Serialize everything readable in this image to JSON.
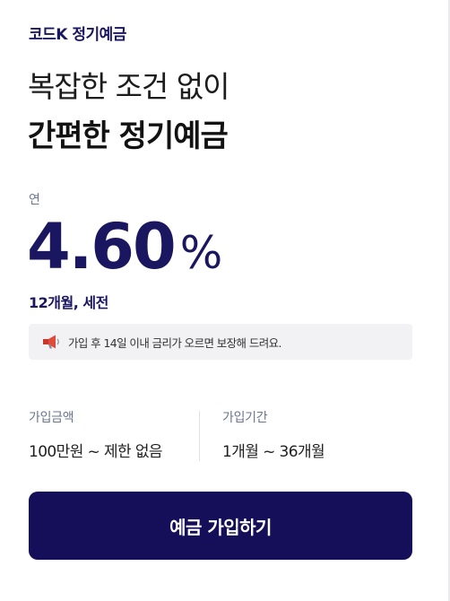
{
  "product": {
    "label": "코드K 정기예금",
    "headline_line1": "복잡한 조건 없이",
    "headline_line2": "간편한 정기예금"
  },
  "rate": {
    "caption": "연",
    "value": "4.60",
    "unit": "%",
    "terms": "12개월, 세전"
  },
  "notice": {
    "icon": "megaphone-icon",
    "text": "가입 후 14일 이내 금리가 오르면 보장해 드려요."
  },
  "details": {
    "amount_label": "가입금액",
    "amount_value": "100만원 ~ 제한 없음",
    "period_label": "가입기간",
    "period_value": "1개월 ~ 36개월"
  },
  "cta": {
    "label": "예금 가입하기"
  },
  "colors": {
    "brand_navy": "#140f58",
    "text_navy": "#1a1660",
    "muted": "#6a7590",
    "notice_bg": "#f2f2f4"
  }
}
